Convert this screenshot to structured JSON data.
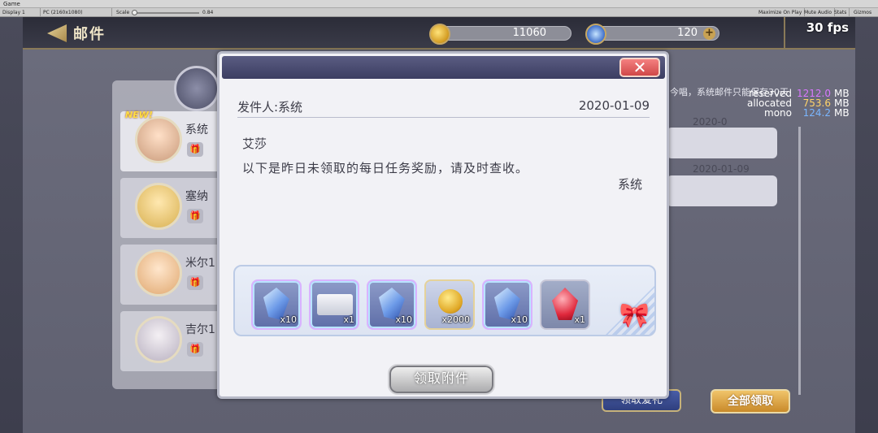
{
  "editor": {
    "window_title": "Game",
    "display": "Display 1",
    "resolution": "PC (2160x1080)",
    "scale_label": "Scale",
    "scale_value": "0.84",
    "toolbar_right": [
      "Maximize On Play",
      "Mute Audio",
      "Stats",
      "Gizmos"
    ]
  },
  "hud": {
    "title": "邮件",
    "coins": "11060",
    "gems": "120",
    "plus": "+",
    "fps": "30 fps"
  },
  "debug": [
    {
      "label": "reserved",
      "value": "1212.0",
      "unit": "MB",
      "color": "#d978ff"
    },
    {
      "label": "allocated",
      "value": "753.6",
      "unit": "MB",
      "color": "#ffd46a"
    },
    {
      "label": "mono",
      "value": "124.2",
      "unit": "MB",
      "color": "#7ab6ff"
    }
  ],
  "mail_list": [
    {
      "name": "系统",
      "new": "NEW!",
      "gift": "🎁"
    },
    {
      "name": "塞纳",
      "gift": "🎁"
    },
    {
      "name": "米尔1",
      "gift": "🎁"
    },
    {
      "name": "吉尔1",
      "gift": "🎁"
    }
  ],
  "right_panel": {
    "note": "今唱，系统邮件只能保存30天",
    "dates": [
      "2020-0",
      "2020-01-09"
    ]
  },
  "bottom_buttons": {
    "receive_gift": "领取爱礼",
    "receive_all": "全部领取"
  },
  "modal": {
    "close": "✕",
    "sender": "发件人:系统",
    "date": "2020-01-09",
    "recipient": "艾莎",
    "body": "以下是昨日未领取的每日任务奖励，请及时查收。",
    "signature": "系统",
    "attachments": [
      {
        "type": "crystal",
        "qty": "x10"
      },
      {
        "type": "ticket",
        "qty": "x1"
      },
      {
        "type": "crystal",
        "qty": "x10"
      },
      {
        "type": "coin",
        "qty": "x2000"
      },
      {
        "type": "crystal",
        "qty": "x10"
      },
      {
        "type": "ruby",
        "qty": "x1"
      }
    ],
    "claim_button": "领取附件"
  }
}
